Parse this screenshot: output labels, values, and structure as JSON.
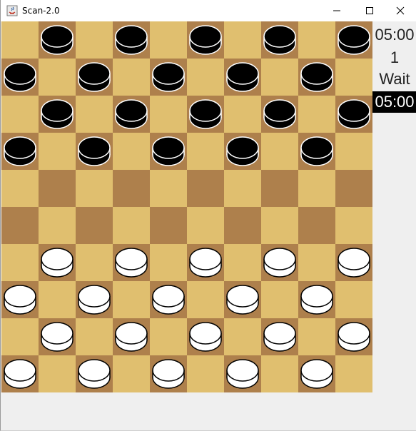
{
  "window": {
    "title": "Scan-2.0",
    "icon": "java-cup-icon"
  },
  "colors": {
    "light_square": "#e0bf6f",
    "dark_square": "#ae804c",
    "black_piece": "#000000",
    "white_piece": "#ffffff"
  },
  "board": {
    "size": 10,
    "black_pieces": [
      1,
      3,
      5,
      7,
      9,
      10,
      12,
      14,
      16,
      18,
      21,
      23,
      25,
      27,
      29,
      30,
      32,
      34,
      36,
      38
    ],
    "white_pieces": [
      61,
      63,
      65,
      67,
      69,
      70,
      72,
      74,
      76,
      78,
      81,
      83,
      85,
      87,
      89,
      90,
      92,
      94,
      96,
      98
    ]
  },
  "sidebar": {
    "clock_top": "05:00",
    "move_number": "1",
    "status": "Wait",
    "clock_bottom": "05:00"
  }
}
